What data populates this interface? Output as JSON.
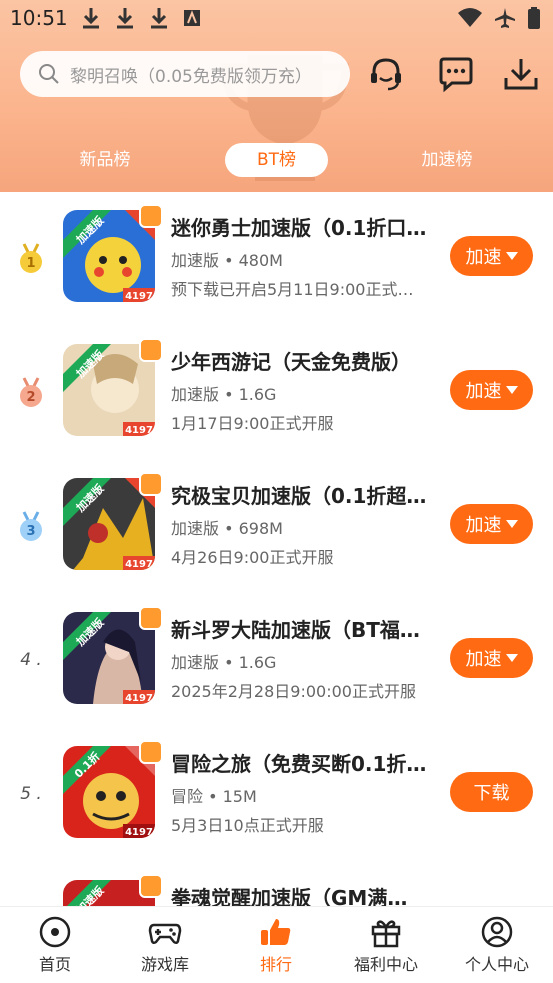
{
  "statusbar": {
    "time": "10:51"
  },
  "search": {
    "placeholder": "黎明召唤（0.05免费版领万充）"
  },
  "tabs": [
    {
      "label": "新品榜"
    },
    {
      "label": "BT榜"
    },
    {
      "label": "加速榜"
    }
  ],
  "games": [
    {
      "rank": "1",
      "badge": "加速版",
      "title": "迷你勇士加速版（0.1折口…",
      "meta": "加速版 • 480M",
      "desc": "预下载已开启5月11日9:00正式…",
      "button": "加速",
      "colors": [
        "#2a6fd6",
        "#f4d23c"
      ]
    },
    {
      "rank": "2",
      "badge": "加速版",
      "title": "少年西游记（天金免费版）",
      "meta": "加速版 • 1.6G",
      "desc": "1月17日9:00正式开服",
      "button": "加速",
      "colors": [
        "#e9d7b8",
        "#c7a97a"
      ]
    },
    {
      "rank": "3",
      "badge": "加速版",
      "title": "究极宝贝加速版（0.1折超…",
      "meta": "加速版 • 698M",
      "desc": "4月26日9:00正式开服",
      "button": "加速",
      "colors": [
        "#3b3b3b",
        "#e6b020"
      ]
    },
    {
      "rank": "4 .",
      "badge": "加速版",
      "title": "新斗罗大陆加速版（BT福…",
      "meta": "加速版 • 1.6G",
      "desc": "2025年2月28日9:00:00正式开服",
      "button": "加速",
      "colors": [
        "#2c2a4a",
        "#d9b7a6"
      ]
    },
    {
      "rank": "5 .",
      "badge": "0.1折",
      "title": "冒险之旅（免费买断0.1折…",
      "meta": "冒险 • 15M",
      "desc": "5月3日10点正式开服",
      "button": "下载",
      "colors": [
        "#d8241b",
        "#f5c44a"
      ]
    },
    {
      "rank": "",
      "badge": "加速版",
      "title": "拳魂觉醒加速版（GM满…",
      "meta": "",
      "desc": "",
      "button": "",
      "colors": [
        "#c62020",
        "#7a1010"
      ]
    }
  ],
  "corner_tag": "4197",
  "nav": [
    {
      "label": "首页",
      "icon": "home-icon"
    },
    {
      "label": "游戏库",
      "icon": "gamepad-icon"
    },
    {
      "label": "排行",
      "icon": "thumbs-up-icon"
    },
    {
      "label": "福利中心",
      "icon": "gift-icon"
    },
    {
      "label": "个人中心",
      "icon": "user-icon"
    }
  ],
  "accent_color": "#ff6a13"
}
